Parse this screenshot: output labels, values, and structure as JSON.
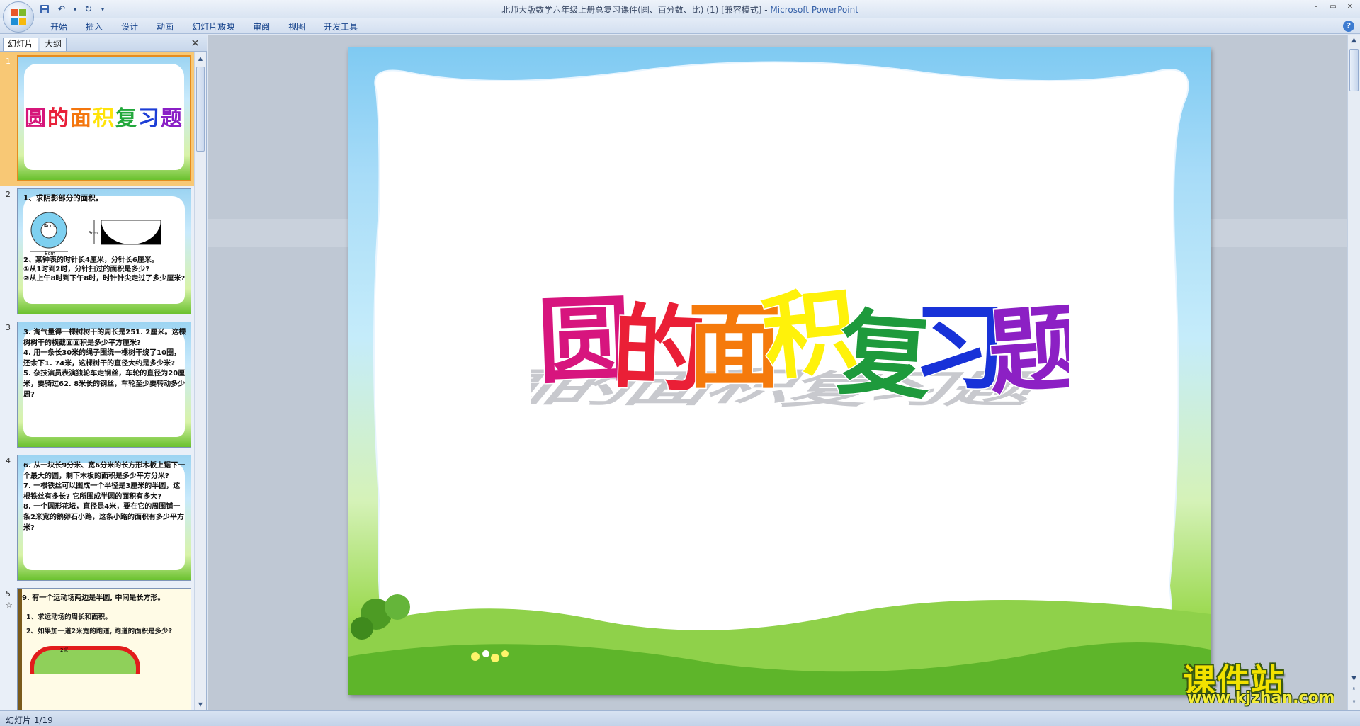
{
  "window": {
    "title_doc": "北师大版数学六年级上册总复习课件(圆、百分数、比) (1) [兼容模式]",
    "title_sep": " - ",
    "title_app": "Microsoft PowerPoint",
    "controls": {
      "minimize": "–",
      "restore": "▭",
      "close": "✕"
    }
  },
  "ribbon": {
    "tabs": [
      "开始",
      "插入",
      "设计",
      "动画",
      "幻灯片放映",
      "审阅",
      "视图",
      "开发工具"
    ],
    "help": "?"
  },
  "left_panel": {
    "tab_slides": "幻灯片",
    "tab_outline": "大纲",
    "close": "✕",
    "slides": [
      {
        "num": "1",
        "title_chars": [
          "圆",
          "的",
          "面",
          "积",
          "复",
          "习",
          "题"
        ]
      },
      {
        "num": "2",
        "q1": "1、求阴影部分的面积。",
        "lbl_4cm": "4cm",
        "lbl_8cm": "8cm",
        "lbl_3cm": "3cm",
        "q2": "2、某钟表的时针长4厘米，分针长6厘米。\n①从1时到2时，分针扫过的面积是多少?\n②从上午8时到下午8时，时针针尖走过了多少厘米?"
      },
      {
        "num": "3",
        "text": "3. 淘气量得一棵树树干的周长是251. 2厘米。这棵树树干的横截面面积是多少平方厘米?\n4. 用一条长30米的绳子围绕一棵树干绕了10圈，还余下1. 74米，这棵树干的直径大约是多少米?\n5. 杂技演员表演独轮车走钢丝，车轮的直径为20厘米，要骑过62. 8米长的钢丝，车轮至少要转动多少周?"
      },
      {
        "num": "4",
        "text": "6. 从一块长9分米、宽6分米的长方形木板上锯下一个最大的圆，剩下木板的面积是多少平方分米?\n7. 一根铁丝可以围成一个半径是3厘米的半圆，这根铁丝有多长? 它所围成半圆的面积有多大?\n8. 一个圆形花坛，直径是4米，要在它的周围铺一条2米宽的鹅卵石小路，这条小路的面积有多少平方米?"
      },
      {
        "num": "5",
        "anim": "☆",
        "text": "9. 有一个运动场两边是半圆, 中间是长方形。",
        "sub1": "1、求运动场的周长和面积。",
        "sub2": "2、如果加一道2米宽的跑道, 跑道的面积是多少?",
        "lbl_2m": "2米"
      }
    ]
  },
  "main_slide": {
    "title_chars": [
      "圆",
      "的",
      "面",
      "积",
      "复",
      "习",
      "题"
    ],
    "title_colors": [
      "#d7157e",
      "#ea1f36",
      "#f57a0c",
      "#fff20a",
      "#1e9a3c",
      "#1832d8",
      "#8c20c4"
    ]
  },
  "status": {
    "text": "幻灯片 1/19"
  },
  "watermark": {
    "cn": "课件站",
    "url": "www.kjzhan.com"
  }
}
